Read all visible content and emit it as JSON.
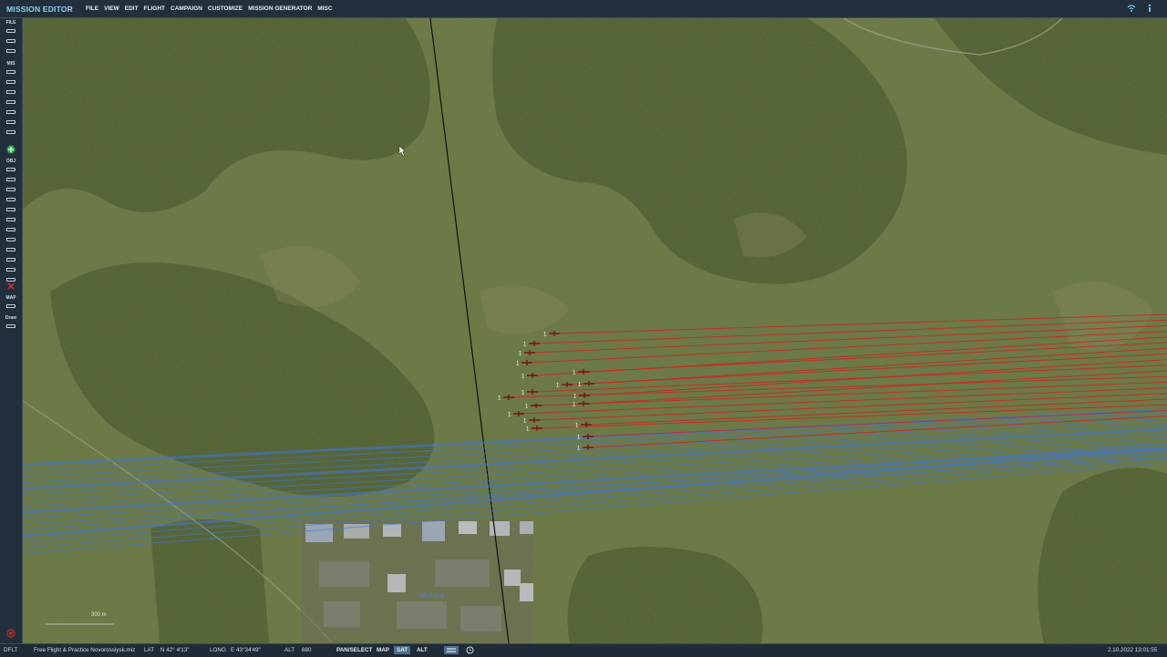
{
  "app": {
    "title": "MISSION EDITOR"
  },
  "menu": [
    "FILE",
    "VIEW",
    "EDIT",
    "FLIGHT",
    "CAMPAIGN",
    "CUSTOMIZE",
    "MISSION GENERATOR",
    "MISC"
  ],
  "sidebar": {
    "file_label": "FILE",
    "mis_label": "MIS",
    "obj_label": "OBJ",
    "map_label": "MAP",
    "draw_label": "Draw"
  },
  "map": {
    "scale_label": "300 m",
    "town_label": "Volodarsk",
    "unit_label": "1",
    "colors": {
      "red_route": "#d61d1d",
      "blue_route": "#3f76e0",
      "marker": "#7a1212"
    }
  },
  "status": {
    "profile": "DFLT",
    "mission": "Free Flight & Practice Novorossiysk.miz",
    "lat_label": "LAT",
    "lat_value": "N 42° 4'13\"",
    "long_label": "LONG",
    "long_value": "E 43°34'49\"",
    "alt_label": "ALT",
    "alt_value": "880",
    "mode_pan": "PAN/SELECT",
    "mode_map": "MAP",
    "mode_sat": "SAT",
    "mode_alt": "ALT",
    "datetime": "2.10.2022 13:01:55"
  }
}
